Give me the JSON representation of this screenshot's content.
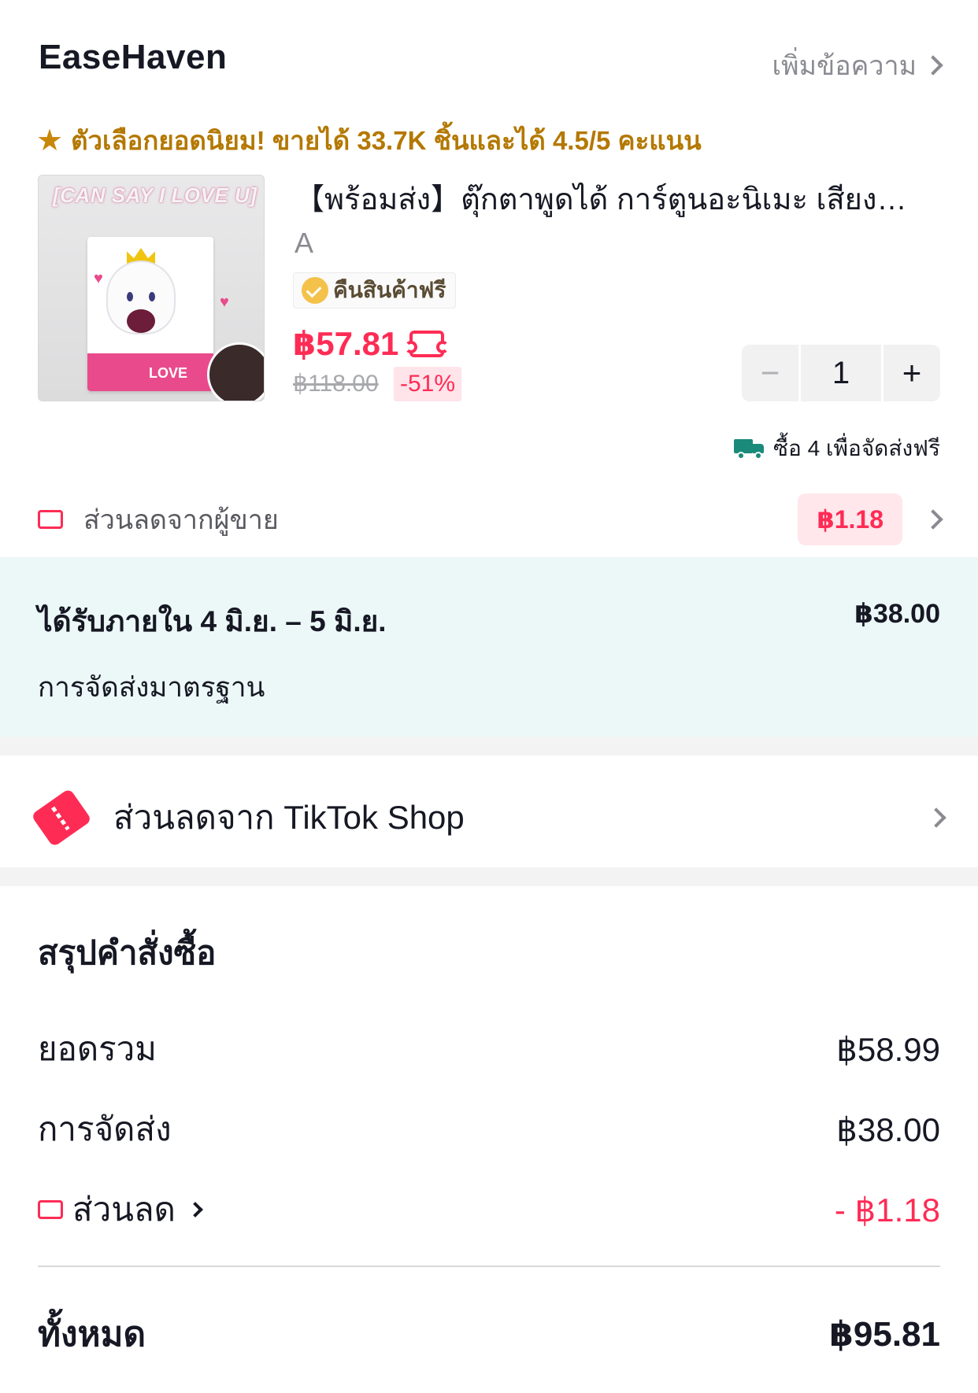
{
  "store": {
    "name": "EaseHaven",
    "add_message": "เพิ่มข้อความ"
  },
  "popular_text": "ตัวเลือกยอดนิยม! ขายได้ 33.7K ชิ้นและได้ 4.5/5 คะแนน",
  "product": {
    "image_banner": "[CAN SAY I LOVE U]",
    "image_box_text": "LOVE",
    "title": "【พร้อมส่ง】ตุ๊กตาพูดได้ การ์ตูนอะนิเมะ เสียง…",
    "variant": "A",
    "free_return": "คืนสินค้าฟรี",
    "price": "฿57.81",
    "original_price": "฿118.00",
    "discount": "-51%",
    "quantity": "1",
    "free_shipping_hint": "ซื้อ 4 เพื่อจัดส่งฟรี"
  },
  "seller_discount": {
    "label": "ส่วนลดจากผู้ขาย",
    "value": "฿1.18"
  },
  "delivery": {
    "when": "ได้รับภายใน 4 มิ.ย. – 5 มิ.ย.",
    "fee": "฿38.00",
    "method": "การจัดส่งมาตรฐาน"
  },
  "tiktok_discount": {
    "label": "ส่วนลดจาก TikTok Shop"
  },
  "summary": {
    "title": "สรุปคำสั่งซื้อ",
    "subtotal_label": "ยอดรวม",
    "subtotal_value": "฿58.99",
    "shipping_label": "การจัดส่ง",
    "shipping_value": "฿38.00",
    "discount_label": "ส่วนลด",
    "discount_value": "- ฿1.18",
    "total_label": "ทั้งหมด",
    "total_value": "฿95.81"
  },
  "colors": {
    "accent": "#fe2c55",
    "gold": "#b47800",
    "delivery_band": "#ecf7f8",
    "truck": "#1a8a7a"
  },
  "icons": [
    "chevron-right-icon",
    "star-icon",
    "return-check-icon",
    "coupon-icon",
    "minus-icon",
    "plus-icon",
    "truck-icon",
    "tiktok-coupon-icon"
  ]
}
